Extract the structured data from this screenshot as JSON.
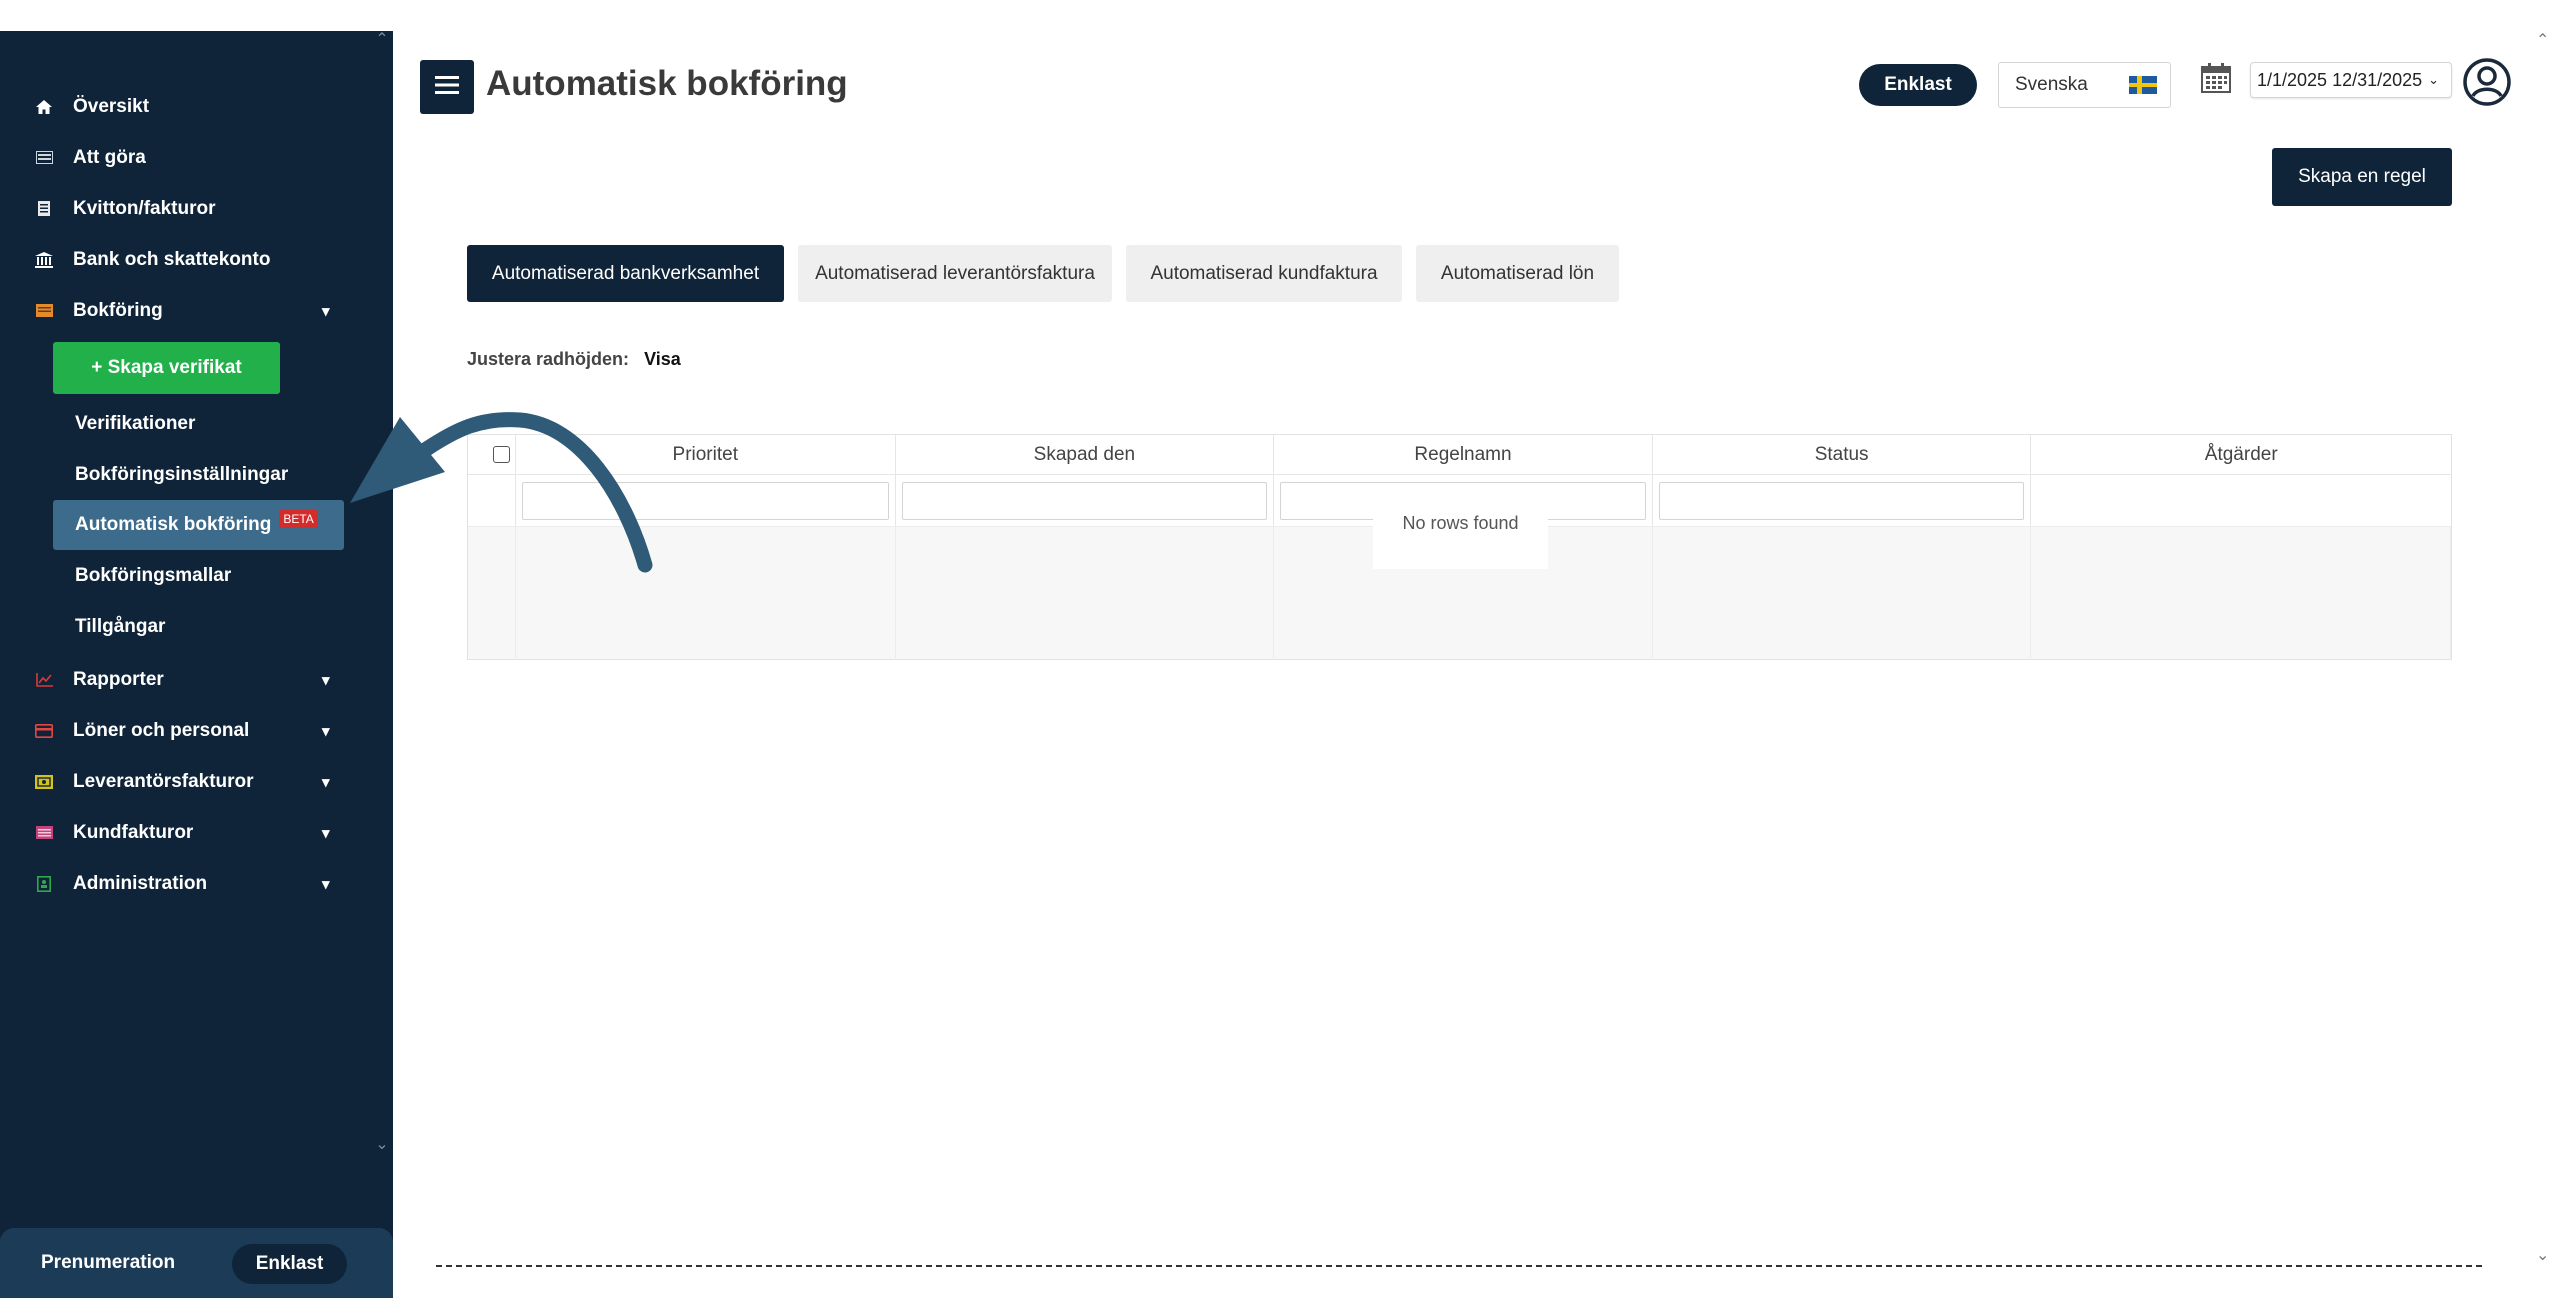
{
  "sidebar": {
    "items": [
      {
        "label": "Översikt",
        "icon": "home-icon"
      },
      {
        "label": "Att göra",
        "icon": "list-icon"
      },
      {
        "label": "Kvitton/fakturor",
        "icon": "receipt-icon"
      },
      {
        "label": "Bank och skattekonto",
        "icon": "bank-icon"
      },
      {
        "label": "Bokföring",
        "icon": "book-icon"
      }
    ],
    "create_label": "+ Skapa verifikat",
    "sub_items": [
      {
        "label": "Verifikationer"
      },
      {
        "label": "Bokföringsinställningar"
      },
      {
        "label": "Automatisk bokföring",
        "badge": "BETA",
        "active": true
      },
      {
        "label": "Bokföringsmallar"
      },
      {
        "label": "Tillgångar"
      }
    ],
    "more_items": [
      {
        "label": "Rapporter",
        "icon": "chart-icon",
        "color": "#d93a3a"
      },
      {
        "label": "Löner och personal",
        "icon": "card-icon",
        "color": "#e2473f"
      },
      {
        "label": "Leverantörsfakturor",
        "icon": "invoice-icon",
        "color": "#d4c21e"
      },
      {
        "label": "Kundfakturor",
        "icon": "customer-invoice-icon",
        "color": "#c1457c"
      },
      {
        "label": "Administration",
        "icon": "admin-icon",
        "color": "#2fa84a"
      }
    ],
    "footer": {
      "label": "Prenumeration",
      "plan": "Enklast"
    }
  },
  "header": {
    "title": "Automatisk bokföring",
    "plan": "Enklast",
    "language": "Svenska",
    "date_range": "1/1/2025 12/31/2025"
  },
  "create_rule_label": "Skapa en regel",
  "tabs": [
    {
      "label": "Automatiserad bankverksamhet",
      "active": true
    },
    {
      "label": "Automatiserad leverantörsfaktura"
    },
    {
      "label": "Automatiserad kundfaktura"
    },
    {
      "label": "Automatiserad lön"
    }
  ],
  "row_height": {
    "label": "Justera radhöjden:",
    "value": "Visa"
  },
  "table": {
    "columns": [
      "Prioritet",
      "Skapad den",
      "Regelnamn",
      "Status",
      "Åtgärder"
    ],
    "empty_text": "No rows found"
  },
  "colors": {
    "navy": "#0f2438",
    "green": "#22b04b",
    "active_item": "#3d6b8c",
    "beta": "#d42b2b"
  }
}
